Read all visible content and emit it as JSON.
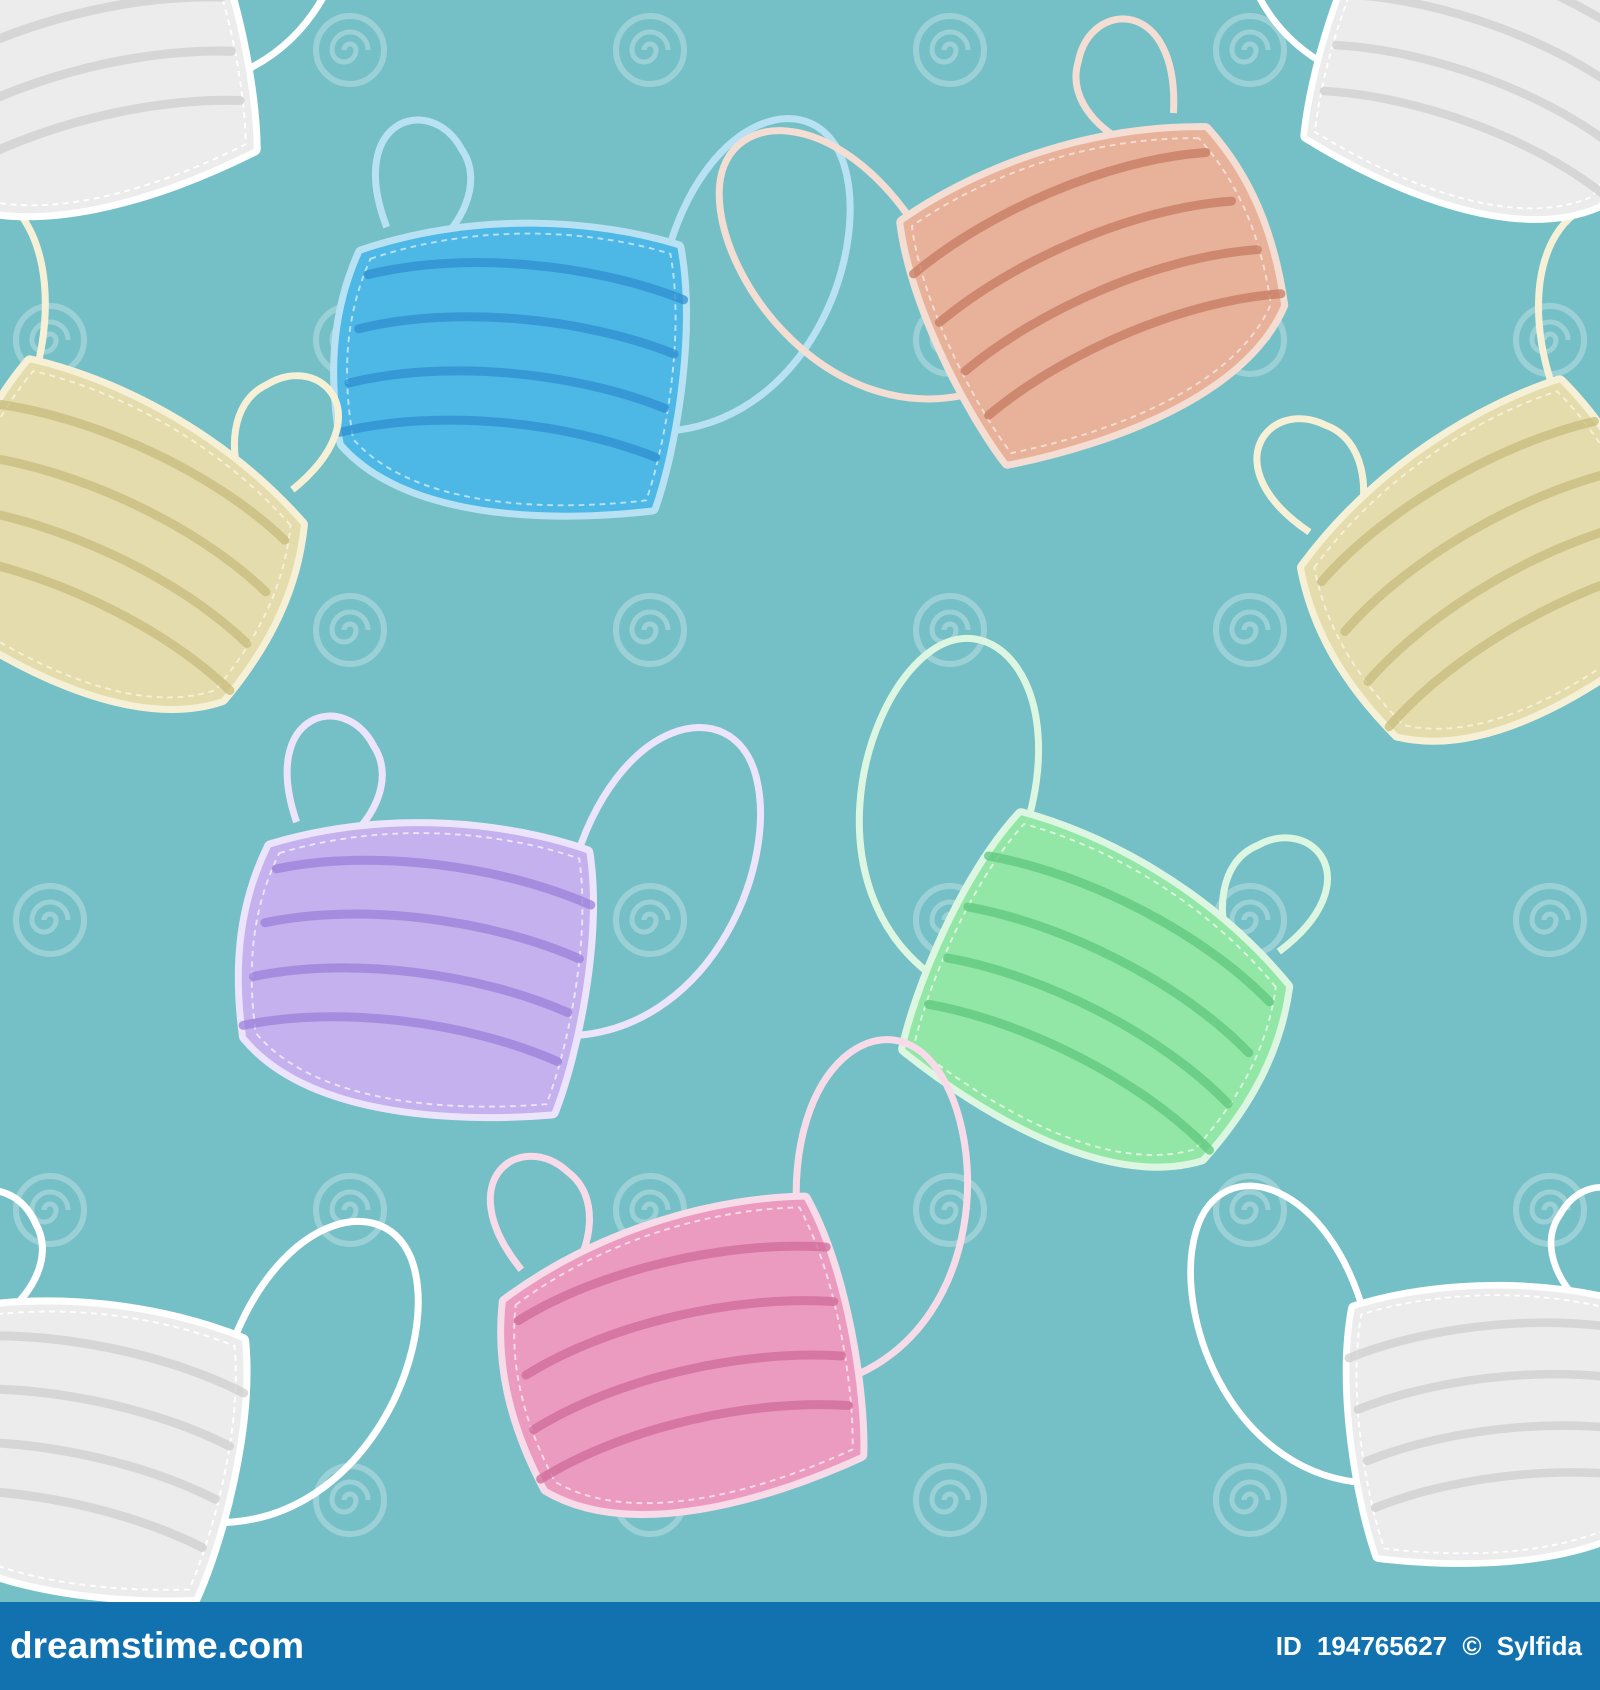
{
  "background_color": "#75c0c6",
  "footer_color": "#1272b0",
  "watermark_icon": "dreamstime-spiral-icon",
  "masks": [
    {
      "name": "blue",
      "fill": "#4db8e6",
      "pleat": "#2f8fcf",
      "trim": "#b8e2f4"
    },
    {
      "name": "peach",
      "fill": "#e8b19a",
      "pleat": "#c67b62",
      "trim": "#f4ddd3"
    },
    {
      "name": "beige",
      "fill": "#e4dcac",
      "pleat": "#c7bc7d",
      "trim": "#f6f1d6"
    },
    {
      "name": "violet",
      "fill": "#c4b1ee",
      "pleat": "#9b80da",
      "trim": "#ece4fb"
    },
    {
      "name": "green",
      "fill": "#92e6a6",
      "pleat": "#5dc77c",
      "trim": "#dcf6e1"
    },
    {
      "name": "pink",
      "fill": "#ec9bc0",
      "pleat": "#cf6a98",
      "trim": "#f8dbe8"
    },
    {
      "name": "white",
      "fill": "#ececec",
      "pleat": "#cfcfcf",
      "trim": "#ffffff"
    }
  ],
  "footer": {
    "site": "dreamstime.com",
    "id_label": "ID",
    "id_value": "194765627",
    "copyright_symbol": "©",
    "author": "Sylfida"
  }
}
